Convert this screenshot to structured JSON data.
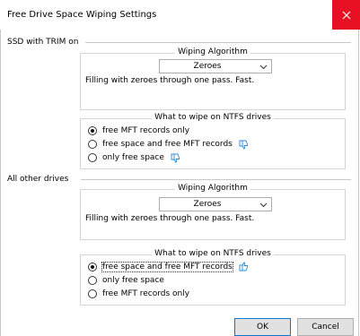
{
  "window": {
    "title": "Free Drive Space Wiping Settings",
    "close_icon": "close-icon",
    "accent_close": "#e81123"
  },
  "sections": [
    {
      "label": "SSD with TRIM on",
      "algorithm_group": {
        "legend": "Wiping Algorithm",
        "selected": "Zeroes",
        "description": "Filling with zeroes through one pass. Fast."
      },
      "ntfs_group": {
        "legend": "What to wipe on NTFS drives",
        "options": [
          {
            "label": "free MFT records only",
            "checked": true,
            "thumb": ""
          },
          {
            "label": "free space and free MFT records",
            "checked": false,
            "thumb": "thumbs-down-icon"
          },
          {
            "label": "only free space",
            "checked": false,
            "thumb": "thumbs-down-icon"
          }
        ]
      }
    },
    {
      "label": "All other drives",
      "algorithm_group": {
        "legend": "Wiping Algorithm",
        "selected": "Zeroes",
        "description": "Filling with zeroes through one pass. Fast."
      },
      "ntfs_group": {
        "legend": "What to wipe on NTFS drives",
        "options": [
          {
            "label": "free space and free MFT records",
            "checked": true,
            "thumb": "thumbs-up-icon"
          },
          {
            "label": "only free space",
            "checked": false,
            "thumb": ""
          },
          {
            "label": "free MFT records only",
            "checked": false,
            "thumb": ""
          }
        ]
      }
    }
  ],
  "buttons": {
    "ok": "OK",
    "cancel": "Cancel"
  },
  "colors": {
    "thumb_icon": "#2b88d8",
    "default_button_border": "#0078d7"
  }
}
